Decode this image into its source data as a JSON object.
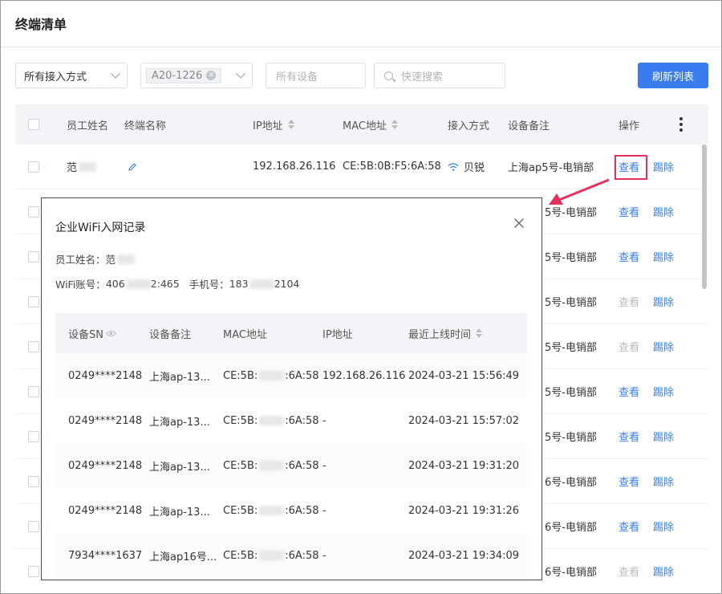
{
  "page": {
    "title": "终端清单"
  },
  "filters": {
    "access_select": "所有接入方式",
    "tag_value": "A20-1226",
    "device_placeholder": "所有设备",
    "search_placeholder": "快速搜索",
    "refresh_label": "刷新列表"
  },
  "table": {
    "headers": {
      "employee": "员工姓名",
      "terminal": "终端名称",
      "ip": "IP地址",
      "mac": "MAC地址",
      "access": "接入方式",
      "note": "设备备注",
      "action": "操作"
    },
    "rows": [
      {
        "name": "范",
        "ip": "192.168.26.116",
        "mac": "CE:5B:0B:F5:6A:58",
        "access": "贝锐",
        "note": "上海ap5号-电销部",
        "view": "查看",
        "view_enabled": true,
        "kick": "踢除"
      },
      {
        "note_tail": "5号-电销部",
        "view": "查看",
        "view_enabled": true,
        "kick": "踢除"
      },
      {
        "note_tail": "5号-电销部",
        "view": "查看",
        "view_enabled": true,
        "kick": "踢除"
      },
      {
        "note_tail": "5号-电销部",
        "view": "查看",
        "view_enabled": false,
        "kick": "踢除"
      },
      {
        "note_tail": "5号-电销部",
        "view": "查看",
        "view_enabled": false,
        "kick": "踢除"
      },
      {
        "note_tail": "5号-电销部",
        "view": "查看",
        "view_enabled": true,
        "kick": "踢除"
      },
      {
        "note_tail": "5号-电销部",
        "view": "查看",
        "view_enabled": true,
        "kick": "踢除"
      },
      {
        "note_tail": "6号-电销部",
        "view": "查看",
        "view_enabled": true,
        "kick": "踢除"
      },
      {
        "note_tail": "6号-电销部",
        "view": "查看",
        "view_enabled": true,
        "kick": "踢除"
      },
      {
        "note_tail": "6号-电销部",
        "view": "查看",
        "view_enabled": false,
        "kick": "踢除"
      }
    ]
  },
  "dialog": {
    "title": "企业WiFi入网记录",
    "employee_label": "员工姓名：",
    "employee_value": "范",
    "wifi_label": "WiFi账号：",
    "wifi_prefix": "406",
    "wifi_suffix": "2:465",
    "phone_label": "手机号：",
    "phone_prefix": "183",
    "phone_suffix": "2104",
    "headers": {
      "sn": "设备SN",
      "note": "设备备注",
      "mac": "MAC地址",
      "ip": "IP地址",
      "last_online": "最近上线时间"
    },
    "rows": [
      {
        "sn": "0249****2148",
        "note": "上海ap-13...",
        "mac_prefix": "CE:5B:",
        "mac_suffix": ":6A:58",
        "ip": "192.168.26.116",
        "time": "2024-03-21 15:56:49"
      },
      {
        "sn": "0249****2148",
        "note": "上海ap-13...",
        "mac_prefix": "CE:5B:",
        "mac_suffix": ":6A:58",
        "ip": "-",
        "time": "2024-03-21 15:57:02"
      },
      {
        "sn": "0249****2148",
        "note": "上海ap-13...",
        "mac_prefix": "CE:5B:",
        "mac_suffix": ":6A:58",
        "ip": "-",
        "time": "2024-03-21 19:31:20"
      },
      {
        "sn": "0249****2148",
        "note": "上海ap-13...",
        "mac_prefix": "CE:5B:",
        "mac_suffix": ":6A:58",
        "ip": "-",
        "time": "2024-03-21 19:31:26"
      },
      {
        "sn": "7934****1637",
        "note": "上海ap16号...",
        "mac_prefix": "CE:5B:",
        "mac_suffix": ":6A:58",
        "ip": "-",
        "time": "2024-03-21 19:34:09"
      }
    ]
  },
  "colors": {
    "primary": "#3a7cf0",
    "highlight": "#e5315b",
    "disabled_link": "#b7bcc4"
  }
}
